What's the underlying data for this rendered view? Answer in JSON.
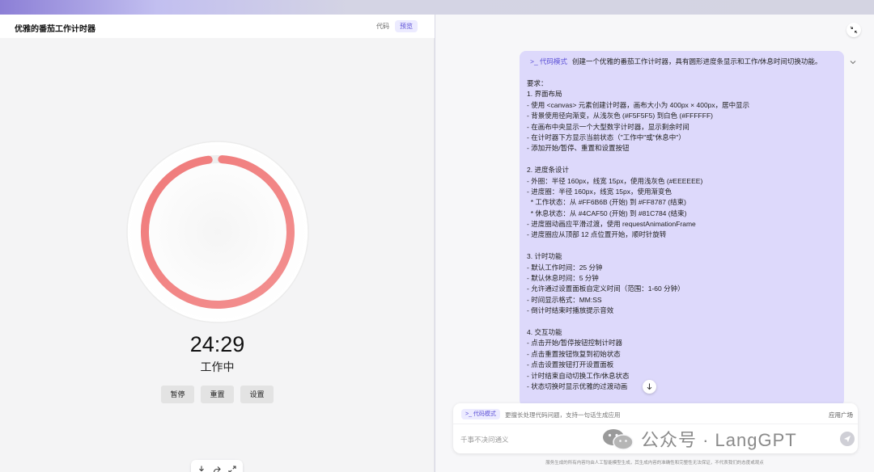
{
  "preview_panel": {
    "title": "优雅的番茄工作计时器",
    "tabs": [
      {
        "label": "代码",
        "active": false
      },
      {
        "label": "预览",
        "active": true
      }
    ],
    "timer": {
      "time": "24:29",
      "status": "工作中",
      "progress": 0.98,
      "gradient_start": "#FF6B6B",
      "gradient_end": "#FF8787"
    },
    "buttons": {
      "pause": "暂停",
      "reset": "重置",
      "settings": "设置"
    },
    "tools": [
      "download-icon",
      "share-icon",
      "expand-icon"
    ]
  },
  "chat": {
    "message": {
      "mode_tag": ">_ 代码模式",
      "first_line": "创建一个优雅的番茄工作计时器，具有圆形进度条显示和工作/休息时间切换功能。",
      "lines": [
        "要求：",
        "1. 界面布局",
        "- 使用 <canvas> 元素创建计时器，画布大小为 400px × 400px，居中显示",
        "- 背景使用径向渐变，从浅灰色 (#F5F5F5) 到白色 (#FFFFFF)",
        "- 在画布中央显示一个大型数字计时器，显示剩余时间",
        "- 在计时器下方显示当前状态（\"工作中\"或\"休息中\"）",
        "- 添加开始/暂停、重置和设置按钮",
        "",
        "2. 进度条设计",
        "- 外圈：半径 160px，线宽 15px，使用浅灰色 (#EEEEEE)",
        "- 进度圈：半径 160px，线宽 15px，使用渐变色",
        "  * 工作状态：从 #FF6B6B (开始) 到 #FF8787 (结束)",
        "  * 休息状态：从 #4CAF50 (开始) 到 #81C784 (结束)",
        "- 进度圈动画应平滑过渡，使用 requestAnimationFrame",
        "- 进度圈应从顶部 12 点位置开始，顺时针旋转",
        "",
        "3. 计时功能",
        "- 默认工作时间：25 分钟",
        "- 默认休息时间：5 分钟",
        "- 允许通过设置面板自定义时间（范围：1-60 分钟）",
        "- 时间显示格式：MM:SS",
        "- 倒计时结束时播放提示音效",
        "",
        "4. 交互功能",
        "- 点击开始/暂停按钮控制计时器",
        "- 点击重置按钮恢复到初始状态",
        "- 点击设置按钮打开设置面板",
        "- 计时结束自动切换工作/休息状态",
        "- 状态切换时显示优雅的过渡动画"
      ]
    },
    "input": {
      "mode_tag": ">_ 代码模式",
      "hint": "更擅长处理代码问题，支持一句话生成应用",
      "app_plaza": "应用广场",
      "placeholder": "千事不决问通义"
    },
    "disclaimer": "服务生成的所有内容均由人工智能模型生成，其生成内容的准确性和完整性无法保证，不代表我们的态度或观点"
  },
  "watermark": {
    "text": "公众号 · LangGPT"
  }
}
